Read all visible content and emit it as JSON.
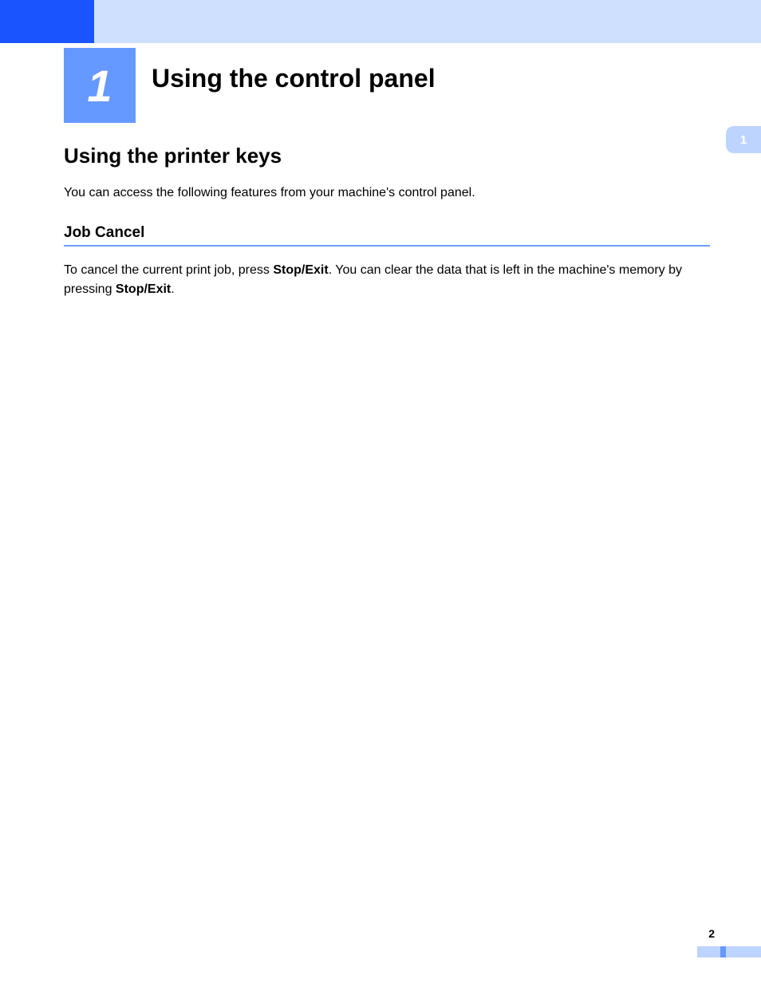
{
  "chapter": {
    "number": "1",
    "title": "Using the control panel"
  },
  "thumb_tab": "1",
  "section": {
    "heading": "Using the printer keys",
    "intro": "You can access the following features from your machine's control panel."
  },
  "subsection": {
    "heading": "Job Cancel",
    "text_part1": "To cancel the current print job, press ",
    "bold1": "Stop/Exit",
    "text_part2": ". You can clear the data that is left in the machine's memory by pressing ",
    "bold2": "Stop/Exit",
    "text_part3": "."
  },
  "page_number": "2"
}
